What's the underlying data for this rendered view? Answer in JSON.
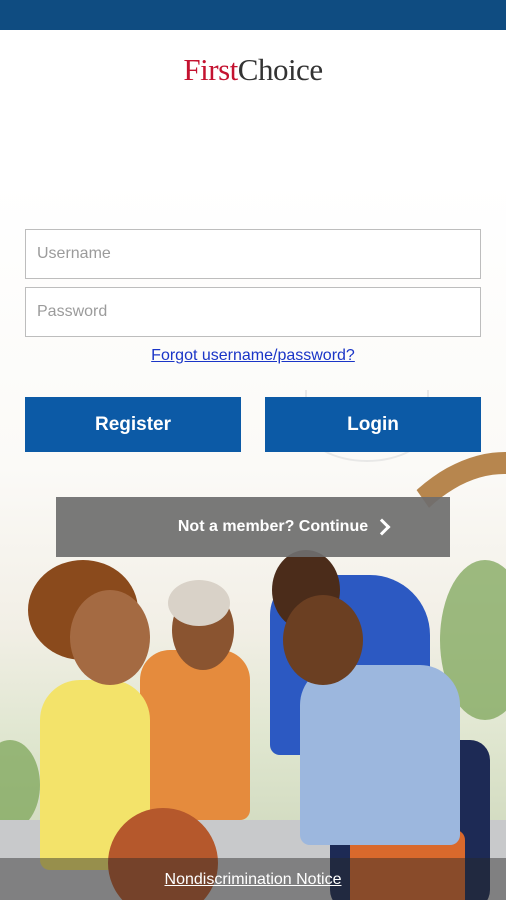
{
  "logo": {
    "first": "First",
    "choice": "Choice"
  },
  "form": {
    "username_placeholder": "Username",
    "password_placeholder": "Password",
    "forgot_link": "Forgot username/password?"
  },
  "buttons": {
    "register": "Register",
    "login": "Login",
    "continue": "Not a member? Continue"
  },
  "footer": {
    "nondiscrimination": "Nondiscrimination Notice"
  },
  "colors": {
    "status_bar": "#0f4c81",
    "brand_red": "#c41230",
    "button_blue": "#0c5aa6",
    "continue_gray": "#6e6e6e",
    "link_blue": "#1a35c7"
  },
  "icons": {
    "continue": "chevron-right-icon"
  },
  "background_image": "family-playing-basketball-photo"
}
